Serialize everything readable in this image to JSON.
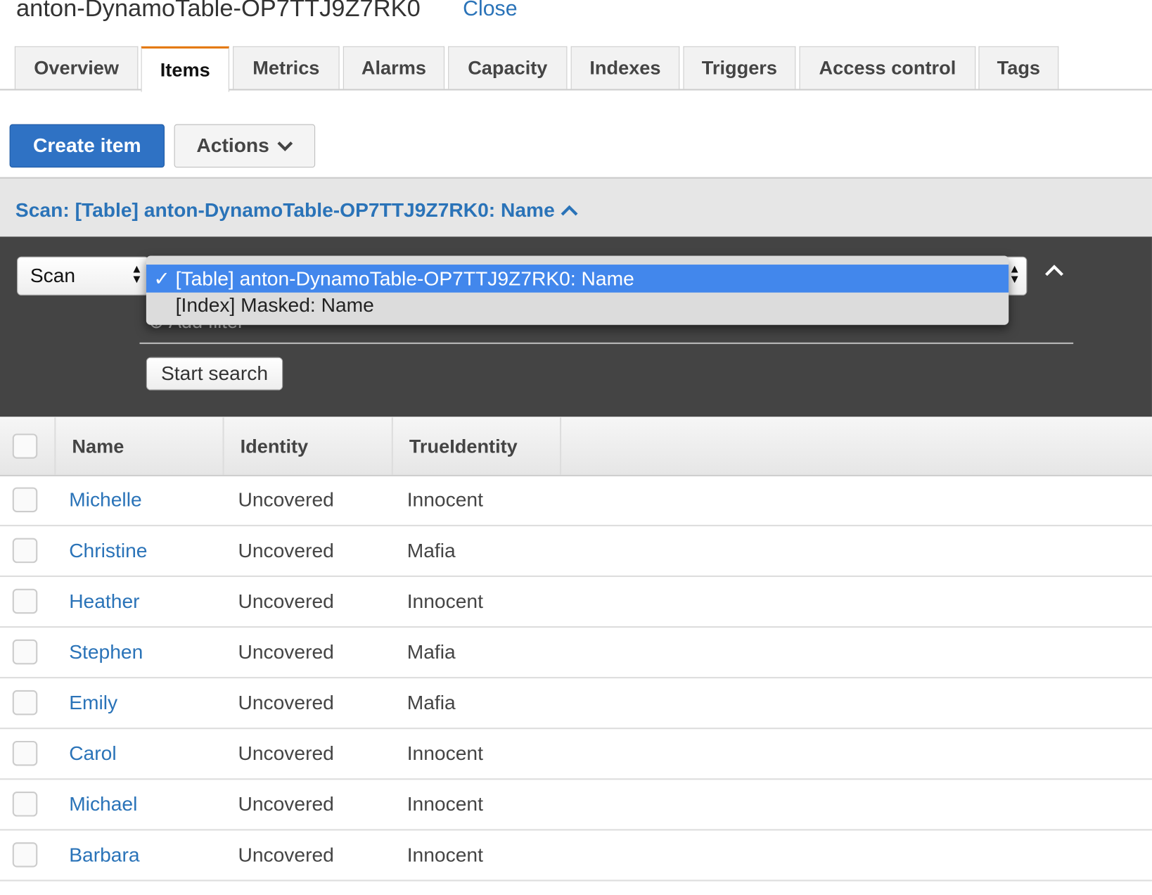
{
  "header": {
    "title": "anton-DynamoTable-OP7TTJ9Z7RK0",
    "close_label": "Close"
  },
  "tabs": [
    {
      "label": "Overview"
    },
    {
      "label": "Items",
      "active": true
    },
    {
      "label": "Metrics"
    },
    {
      "label": "Alarms"
    },
    {
      "label": "Capacity"
    },
    {
      "label": "Indexes"
    },
    {
      "label": "Triggers"
    },
    {
      "label": "Access control"
    },
    {
      "label": "Tags"
    }
  ],
  "toolbar": {
    "create_label": "Create item",
    "actions_label": "Actions"
  },
  "scan": {
    "summary": "Scan: [Table] anton-DynamoTable-OP7TTJ9Z7RK0: Name",
    "mode": "Scan",
    "options": [
      "[Table] anton-DynamoTable-OP7TTJ9Z7RK0: Name",
      "[Index] Masked: Name"
    ],
    "selected_index": 0,
    "add_filter": "Add filter",
    "start_search": "Start search"
  },
  "colors": {
    "accent": "#2f72c4",
    "selection": "#4287ec",
    "active_tab": "#e47911"
  },
  "table": {
    "columns": [
      "Name",
      "Identity",
      "TrueIdentity"
    ],
    "rows": [
      [
        "Michelle",
        "Uncovered",
        "Innocent"
      ],
      [
        "Christine",
        "Uncovered",
        "Mafia"
      ],
      [
        "Heather",
        "Uncovered",
        "Innocent"
      ],
      [
        "Stephen",
        "Uncovered",
        "Mafia"
      ],
      [
        "Emily",
        "Uncovered",
        "Mafia"
      ],
      [
        "Carol",
        "Uncovered",
        "Innocent"
      ],
      [
        "Michael",
        "Uncovered",
        "Innocent"
      ],
      [
        "Barbara",
        "Uncovered",
        "Innocent"
      ]
    ]
  }
}
